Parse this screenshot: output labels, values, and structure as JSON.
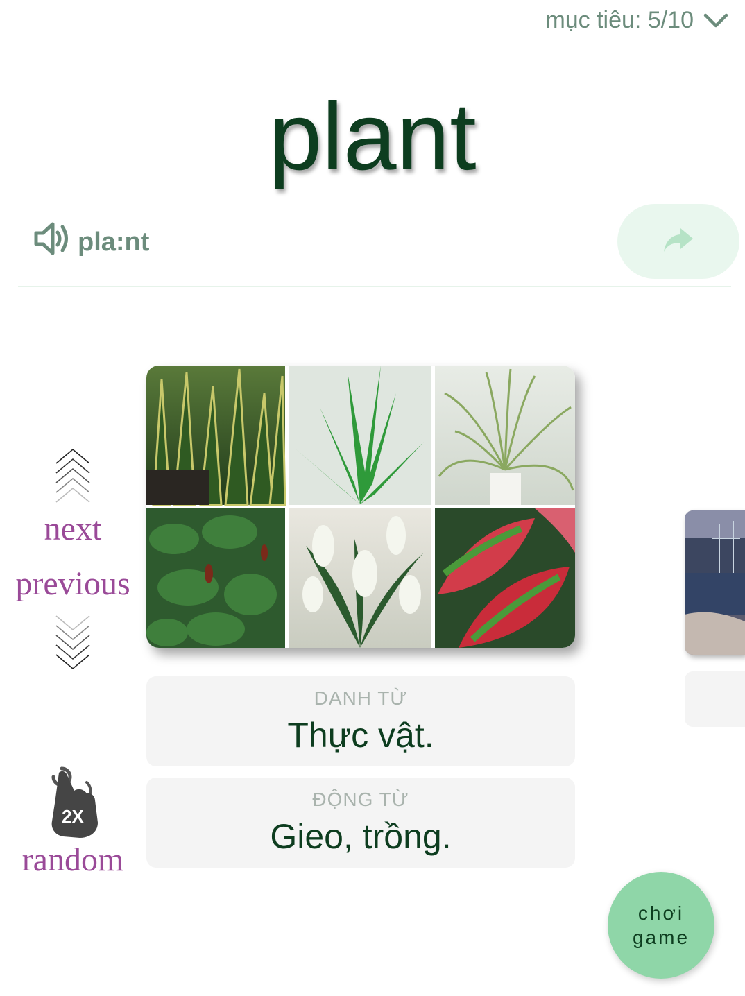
{
  "goal": {
    "label": "mục tiêu: 5/10"
  },
  "word": {
    "text": "plant",
    "phonetic": "pla:nt"
  },
  "nav": {
    "next": "next",
    "previous": "previous",
    "random": "random",
    "double_tap_badge": "2X"
  },
  "definitions": [
    {
      "pos": "DANH TỪ",
      "meaning": "Thực vật."
    },
    {
      "pos": "ĐỘNG TỪ",
      "meaning": "Gieo, trồng."
    }
  ],
  "play_button": {
    "line1": "chơi",
    "line2": "game"
  },
  "icons": {
    "goal_dropdown": "chevron-down-icon",
    "speaker": "speaker-icon",
    "share": "share-forward-icon",
    "next_arrows": "chevrons-up-icon",
    "previous_arrows": "chevrons-down-icon",
    "random": "double-tap-hand-icon"
  },
  "colors": {
    "primary_dark": "#0d3d1f",
    "muted_green": "#6c8c7c",
    "nav_purple": "#9a4a98",
    "play_green": "#8fd6a8",
    "share_bg": "#e9f7ee"
  }
}
